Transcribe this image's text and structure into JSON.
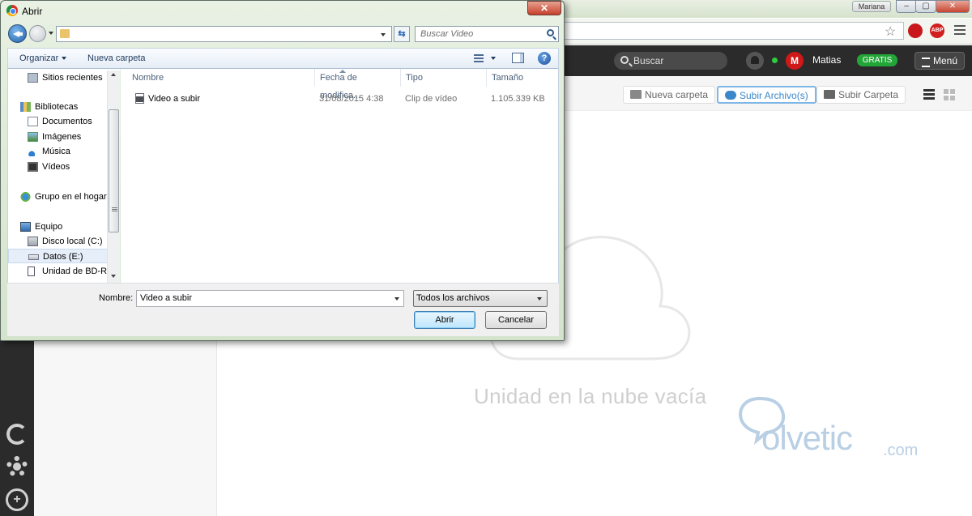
{
  "browser": {
    "profile_name": "Mariana",
    "window_controls": {
      "minimize": "–",
      "restore": "▢",
      "close": "✕"
    }
  },
  "app": {
    "search_placeholder": "Buscar",
    "user_avatar": "M",
    "user_name": "Matias",
    "plan_badge": "GRATIS",
    "menu_label": "Menú",
    "toolbar": {
      "new_folder": "Nueva carpeta",
      "upload_files": "Subir Archivo(s)",
      "upload_folder": "Subir Carpeta"
    },
    "empty_message": "Unidad en la nube vacía",
    "watermark": {
      "text": "olvetic",
      "suffix": ".com"
    }
  },
  "dialog": {
    "title": "Abrir",
    "close_glyph": "✕",
    "search_placeholder": "Buscar Video",
    "refresh_glyph": "⇆",
    "command_bar": {
      "organize": "Organizar",
      "new_folder": "Nueva carpeta",
      "help": "?"
    },
    "nav_items": [
      {
        "label": "Sitios recientes",
        "icon": "recent-places-icon"
      },
      {
        "label": "Bibliotecas",
        "icon": "libraries-icon"
      },
      {
        "label": "Documentos",
        "icon": "documents-icon"
      },
      {
        "label": "Imágenes",
        "icon": "images-icon"
      },
      {
        "label": "Música",
        "icon": "music-icon"
      },
      {
        "label": "Vídeos",
        "icon": "videos-icon"
      },
      {
        "label": "Grupo en el hogar",
        "icon": "homegroup-icon"
      },
      {
        "label": "Equipo",
        "icon": "computer-icon"
      },
      {
        "label": "Disco local (C:)",
        "icon": "local-disk-icon"
      },
      {
        "label": "Datos (E:)",
        "icon": "drive-icon",
        "selected": true
      },
      {
        "label": "Unidad de BD-RO",
        "icon": "bd-drive-icon"
      }
    ],
    "columns": [
      "Nombre",
      "Fecha de modifica...",
      "Tipo",
      "Tamaño"
    ],
    "files": [
      {
        "name": "Video a subir",
        "date": "31/08/2015 4:38",
        "type": "Clip de vídeo",
        "size": "1.105.339 KB"
      }
    ],
    "filename_label": "Nombre:",
    "filename_value": "Video a subir",
    "filetype_selected": "Todos los archivos",
    "open_button": "Abrir",
    "cancel_button": "Cancelar"
  }
}
